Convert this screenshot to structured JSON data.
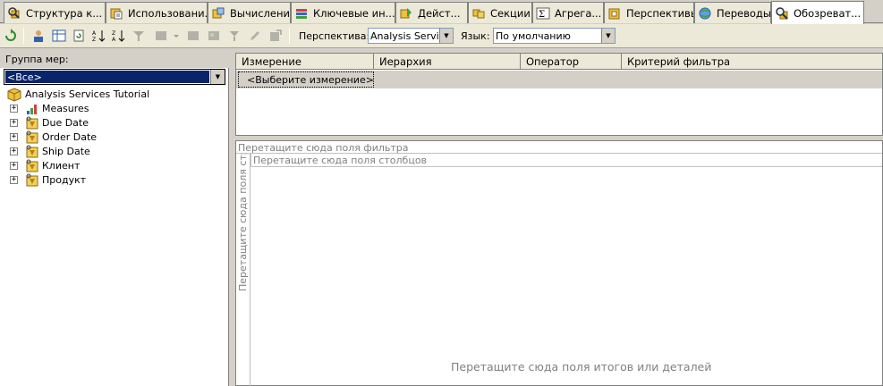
{
  "tabs": [
    {
      "label": "Структура к...",
      "icon": "magnifier-cube-icon"
    },
    {
      "label": "Использовани...",
      "icon": "cube-usage-icon"
    },
    {
      "label": "Вычисления",
      "icon": "calculations-icon"
    },
    {
      "label": "Ключевые ин...",
      "icon": "kpi-icon"
    },
    {
      "label": "Дейст...",
      "icon": "actions-icon"
    },
    {
      "label": "Секции",
      "icon": "partitions-icon"
    },
    {
      "label": "Агрега...",
      "icon": "aggregations-icon"
    },
    {
      "label": "Перспективы",
      "icon": "perspectives-icon"
    },
    {
      "label": "Переводы",
      "icon": "translations-icon"
    },
    {
      "label": "Обозреват...",
      "icon": "browser-icon"
    }
  ],
  "toolbar": {
    "perspective_label": "Перспектива:",
    "perspective_value": "Analysis Services Tutorial",
    "language_label": "Язык:",
    "language_value": "По умолчанию"
  },
  "left_panel": {
    "measure_group_label": "Группа мер:",
    "measure_group_value": "<Все>",
    "tree": {
      "root": "Analysis Services Tutorial",
      "items": [
        {
          "label": "Measures",
          "icon": "measures-icon"
        },
        {
          "label": "Due Date",
          "icon": "dimension-icon"
        },
        {
          "label": "Order Date",
          "icon": "dimension-icon"
        },
        {
          "label": "Ship Date",
          "icon": "dimension-icon"
        },
        {
          "label": "Клиент",
          "icon": "dimension-icon"
        },
        {
          "label": "Продукт",
          "icon": "dimension-icon"
        }
      ]
    }
  },
  "filter_grid": {
    "headers": [
      "Измерение",
      "Иерархия",
      "Оператор",
      "Критерий фильтра"
    ],
    "select_dimension": "<Выберите измерение>"
  },
  "pivot": {
    "filter_drop": "Перетащите сюда поля фильтра",
    "columns_drop": "Перетащите сюда поля столбцов",
    "rows_drop": "Перетащите сюда поля строк",
    "totals_drop": "Перетащите сюда поля итогов или деталей"
  }
}
